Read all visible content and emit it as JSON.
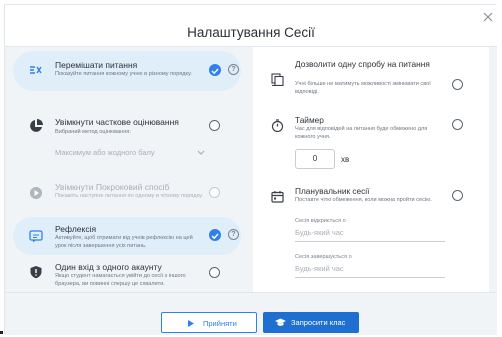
{
  "modal": {
    "title": "Налаштування Сесії",
    "close_icon": "close-icon"
  },
  "left_options": [
    {
      "title": "Перемішати питання",
      "desc": "Показуйте питання кожному учню в різному порядку.",
      "icon": "shuffle-icon",
      "state": "checked"
    },
    {
      "title": "Увімкнути часткове оцінювання",
      "desc": "Вибраний метод оцінювання:",
      "icon": "pie-chart-icon",
      "state": "unchecked",
      "select_value": "Максимум або жодного балу"
    },
    {
      "title": "Увімкнути Покроковий спосіб",
      "desc": "Покажіть наступне питання по одному в чіткому порядку.",
      "icon": "play-circle-icon",
      "state": "disabled"
    },
    {
      "title": "Рефлексія",
      "desc": "Активуйте, щоб отримати від учнів рефлексію на цей урок після завершення усіх питань.",
      "icon": "reflection-icon",
      "state": "checked"
    },
    {
      "title": "Один вхід з одного акаунту",
      "desc": "Якщо студент намагається увійти до сесії з іншого браузера, ви повинні спершу це схвалити.",
      "icon": "shield-icon",
      "state": "unchecked"
    }
  ],
  "right_options": [
    {
      "title": "Дозволити одну спробу на питання",
      "desc": "Учні більше не матимуть можливості змінювати свої відповіді.",
      "icon": "single-attempt-icon"
    },
    {
      "title": "Таймер",
      "desc": "Час для відповідей на питання буде обмежено для кожного учня.",
      "icon": "stopwatch-icon",
      "value": "0",
      "unit": "хв"
    },
    {
      "title": "Планувальник сесії",
      "desc": "Поставте чіткі обмеження, коли можна пройти сесію.",
      "icon": "calendar-icon",
      "start_label": "Сесія відкриється о",
      "start_placeholder": "Будь-який час",
      "end_label": "Сесія завершується о",
      "end_placeholder": "Будь-який час"
    }
  ],
  "footer": {
    "accept_label": "Прийняти",
    "invite_label": "Запросити клас"
  },
  "colors": {
    "accent": "#2f80ed",
    "selected_bg": "#dfeef9",
    "invite_bg": "#1f6fd1"
  }
}
